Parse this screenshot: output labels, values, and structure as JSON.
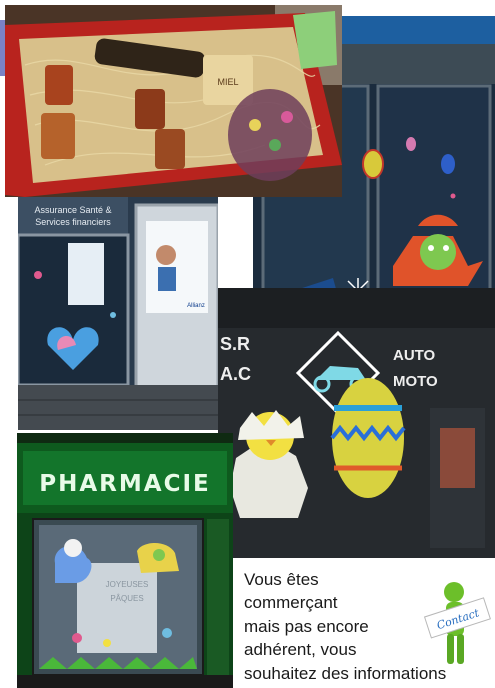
{
  "collage": {
    "gift_photo": {
      "box_label": "MIEL"
    },
    "insurance_photo": {
      "sign_line1": "Assurance Santé &",
      "sign_line2": "Services financiers",
      "poster_brand": "Allianz"
    },
    "moto_photo": {
      "sign_left_line1": "S.R",
      "sign_left_line2": "A.C",
      "sign_right_line1": "AUTO",
      "sign_right_line2": "MOTO"
    },
    "pharmacy_photo": {
      "sign": "PHARMACIE",
      "window_text_line1": "JOYEUSES",
      "window_text_line2": "PÂQUES"
    }
  },
  "call_to_action": {
    "lines": [
      "Vous êtes",
      "commerçant",
      "mais pas encore",
      "adhérent, vous",
      "souhaitez des informations"
    ],
    "contact_sign": "Contact"
  }
}
